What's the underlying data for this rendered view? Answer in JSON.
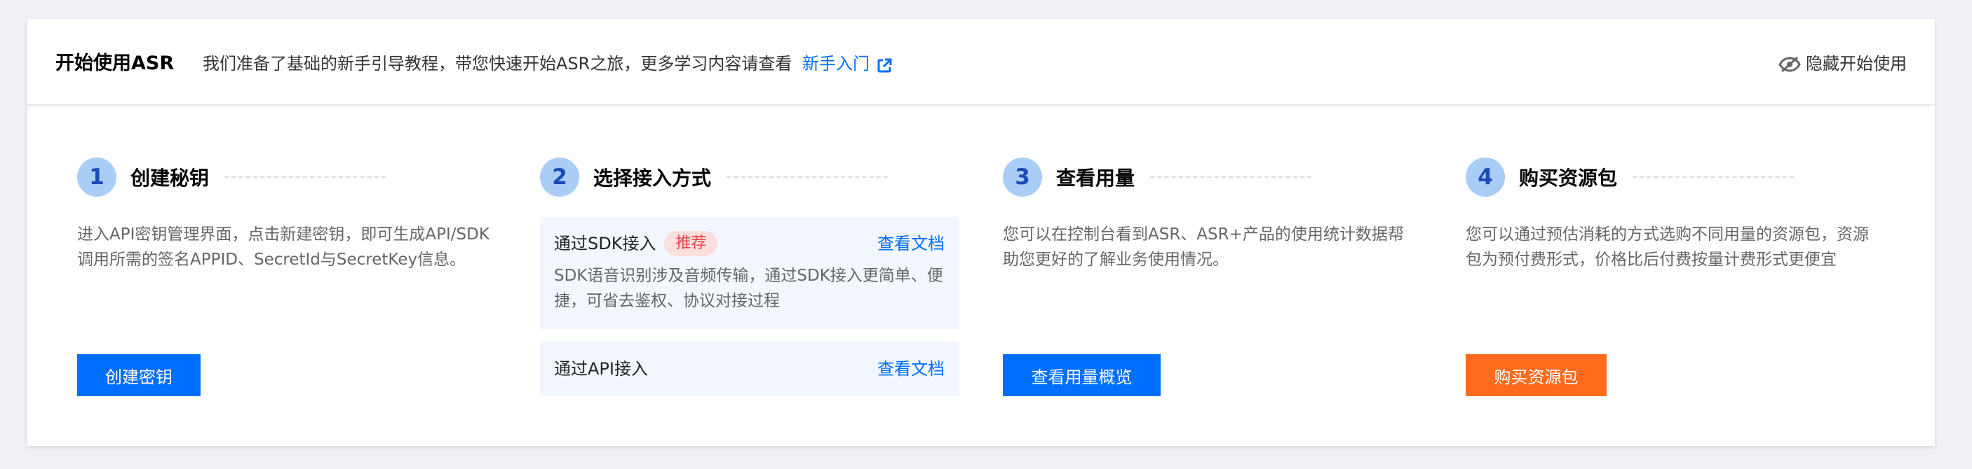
{
  "header": {
    "title": "开始使用ASR",
    "description": "我们准备了基础的新手引导教程，带您快速开始ASR之旅，更多学习内容请查看",
    "link_label": "新手入门",
    "link_icon": "external-link-icon",
    "hide_label": "隐藏开始使用",
    "hide_icon": "eye-hidden-icon"
  },
  "colors": {
    "primary": "#006eff",
    "orange": "#ff6a1d",
    "step_circle": "#a9cdf6",
    "badge_bg": "#fcdedd",
    "badge_text": "#e54545"
  },
  "steps": [
    {
      "number": "1",
      "title": "创建秘钥",
      "description": "进入API密钥管理界面，点击新建密钥，即可生成API/SDK调用所需的签名APPID、SecretId与SecretKey信息。",
      "button": "创建密钥"
    },
    {
      "number": "2",
      "title": "选择接入方式",
      "options": [
        {
          "label": "通过SDK接入",
          "badge": "推荐",
          "link": "查看文档",
          "description": "SDK语音识别涉及音频传输，通过SDK接入更简单、便捷，可省去鉴权、协议对接过程"
        },
        {
          "label": "通过API接入",
          "link": "查看文档"
        }
      ]
    },
    {
      "number": "3",
      "title": "查看用量",
      "description": "您可以在控制台看到ASR、ASR+产品的使用统计数据帮助您更好的了解业务使用情况。",
      "button": "查看用量概览"
    },
    {
      "number": "4",
      "title": "购买资源包",
      "description": "您可以通过预估消耗的方式选购不同用量的资源包，资源包为预付费形式，价格比后付费按量计费形式更便宜",
      "button": "购买资源包"
    }
  ]
}
